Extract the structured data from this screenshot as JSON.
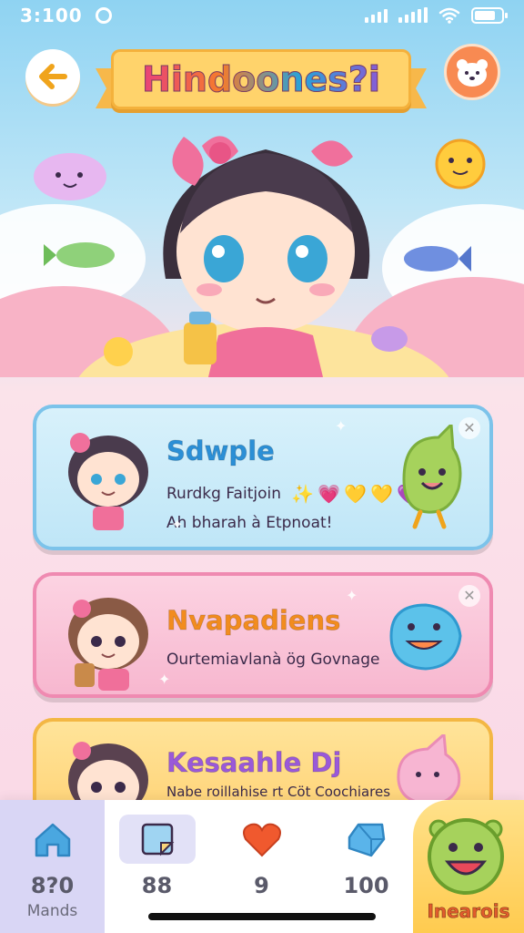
{
  "status_bar": {
    "time": "3:100"
  },
  "header": {
    "title": "Hindoones?i",
    "back_icon": "arrow-left-icon",
    "profile_icon": "bear-face-icon"
  },
  "cards": [
    {
      "title": "Sdwple",
      "line1": "Rurdkg Faitjoin",
      "line2": "Ah bharah à Etpnoat!",
      "hearts": [
        "✨",
        "💗",
        "💛",
        "💛",
        "💜"
      ],
      "colors": {
        "bg": "#bfe6f7",
        "border": "#7cc3ea",
        "title": "#2b8fd6"
      }
    },
    {
      "title": "Nvapadiens",
      "line1": "Ourtemiavlanà ög Govnage",
      "colors": {
        "bg": "#f7b7cf",
        "border": "#ef8ab1",
        "title": "#f28c1e"
      }
    },
    {
      "title": "Kesaahle Dj",
      "line1": "Nabe roillahise rt Cöt Coochiares",
      "colors": {
        "bg": "#ffd070",
        "border": "#f3b744",
        "title": "#9a59d9"
      }
    }
  ],
  "nav": {
    "tabs": [
      {
        "value": "8?0",
        "label": "Mands",
        "icon": "house-icon"
      },
      {
        "value": "88",
        "label": "",
        "icon": "notepad-icon"
      },
      {
        "value": "9",
        "label": "",
        "icon": "heart-icon"
      },
      {
        "value": "100",
        "label": "",
        "icon": "gem-icon"
      }
    ],
    "fab_label": "Inearois",
    "fab_icon": "smiley-face-icon"
  },
  "colors": {
    "accent_orange": "#f88a52",
    "banner_yellow": "#ffd36b",
    "nav_active": "#d9d6f5"
  }
}
